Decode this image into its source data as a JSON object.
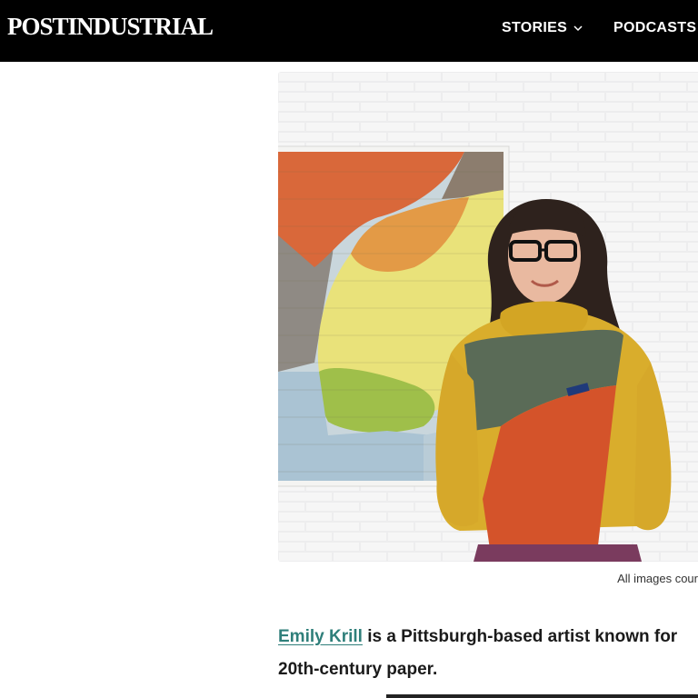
{
  "header": {
    "logo": "POSTINDUSTRIAL",
    "nav": [
      {
        "label": "STORIES",
        "has_dropdown": true
      },
      {
        "label": "PODCASTS",
        "has_dropdown": false
      }
    ]
  },
  "article": {
    "hero_image_alt": "Artist Emily Krill standing in front of a large abstract collage artwork on a white brick wall",
    "caption": "All images cour",
    "lede_link": "Emily Krill",
    "lede_rest_line1": " is a Pittsburgh-based artist known for",
    "lede_line2": "20th-century paper."
  },
  "colors": {
    "link": "#2f7f7a",
    "header_bg": "#000000"
  },
  "icons": {
    "stories_dropdown": "chevron-down-icon"
  }
}
